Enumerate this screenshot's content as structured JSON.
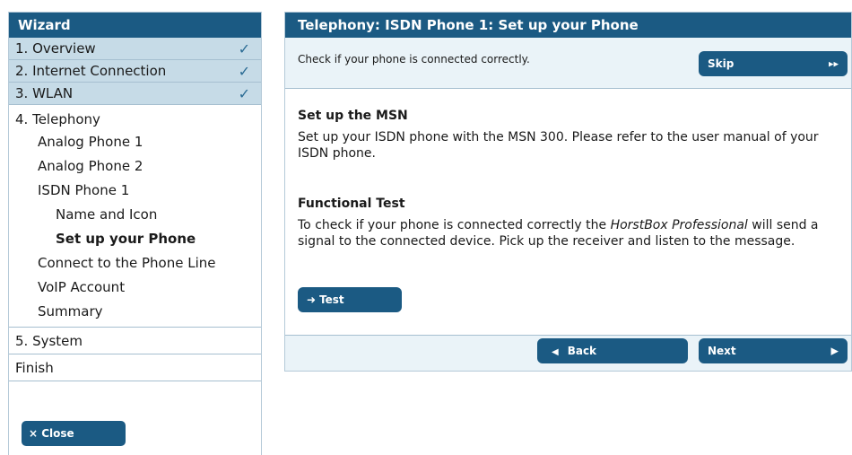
{
  "sidebar": {
    "title": "Wizard",
    "steps_done": [
      {
        "label": "1. Overview",
        "check": "✓"
      },
      {
        "label": "2. Internet Connection",
        "check": "✓"
      },
      {
        "label": "3. WLAN",
        "check": "✓"
      }
    ],
    "telephony": {
      "label": "4. Telephony",
      "items": [
        "Analog Phone 1",
        "Analog Phone 2",
        "ISDN Phone 1"
      ],
      "isdn_subitems": [
        "Name and Icon",
        "Set up your Phone"
      ],
      "more_items": [
        "Connect to the Phone Line",
        "VoIP Account",
        "Summary"
      ]
    },
    "system_label": "5. System",
    "finish_label": "Finish",
    "close_label": "× Close"
  },
  "main": {
    "title": "Telephony: ISDN Phone 1: Set up your Phone",
    "check_text": "Check if your phone is connected correctly.",
    "skip_label": "Skip",
    "msn_title": "Set up the MSN",
    "msn_text": "Set up your ISDN phone with the MSN 300. Please refer to the user manual of your ISDN phone.",
    "ft_title": "Functional Test",
    "ft_text_before": "To check if your phone is connected correctly the ",
    "ft_text_product": "HorstBox Professional",
    "ft_text_after": " will send a signal to the connected device. Pick up the receiver and listen to the message.",
    "test_label": "Test",
    "back_label": "Back",
    "next_label": "Next"
  },
  "icons": {
    "check": "check-icon",
    "close": "close-icon",
    "skip": "double-chevron-right-icon",
    "test": "arrow-right-icon",
    "back": "triangle-left-icon",
    "next": "triangle-right-icon"
  },
  "colors": {
    "header": "#1b5a83",
    "done_step": "#c6dbe7",
    "panel_bar": "#eaf3f8",
    "check": "#2a6b94"
  }
}
